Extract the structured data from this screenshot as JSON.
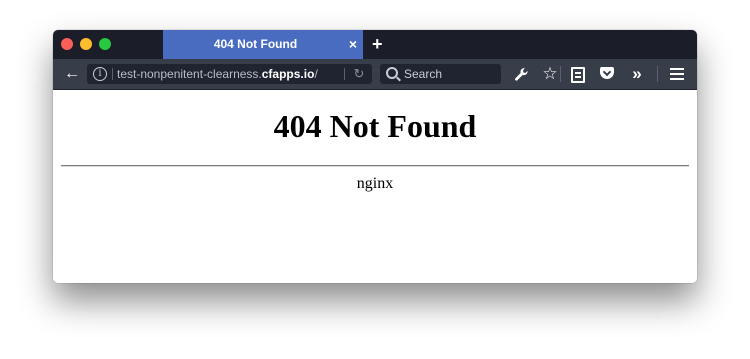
{
  "window": {
    "tab": {
      "title": "404 Not Found",
      "close_label": "×"
    },
    "new_tab_label": "+"
  },
  "toolbar": {
    "back_label": "←",
    "url": {
      "subdomain": "test-nonpenitent-clearness.",
      "host": "cfapps.io",
      "trailing": "/"
    },
    "search": {
      "placeholder": "Search"
    },
    "reload_label": "↻",
    "overflow_label": "»"
  },
  "icons": [
    "traffic-light-close",
    "traffic-light-minimize",
    "traffic-light-maximize",
    "back-arrow-icon",
    "info-icon",
    "reload-icon",
    "search-icon",
    "wrench-icon",
    "star-icon",
    "clipboard-icon",
    "pocket-icon",
    "overflow-icon",
    "hamburger-menu-icon"
  ],
  "colors": {
    "tab_active": "#4a6cc0",
    "tabstrip": "#1b1e28",
    "navbar": "#383d4a",
    "traffic_close": "#fc5f57",
    "traffic_min": "#fdbc2e",
    "traffic_max": "#28c840"
  },
  "page": {
    "heading": "404 Not Found",
    "server": "nginx"
  }
}
